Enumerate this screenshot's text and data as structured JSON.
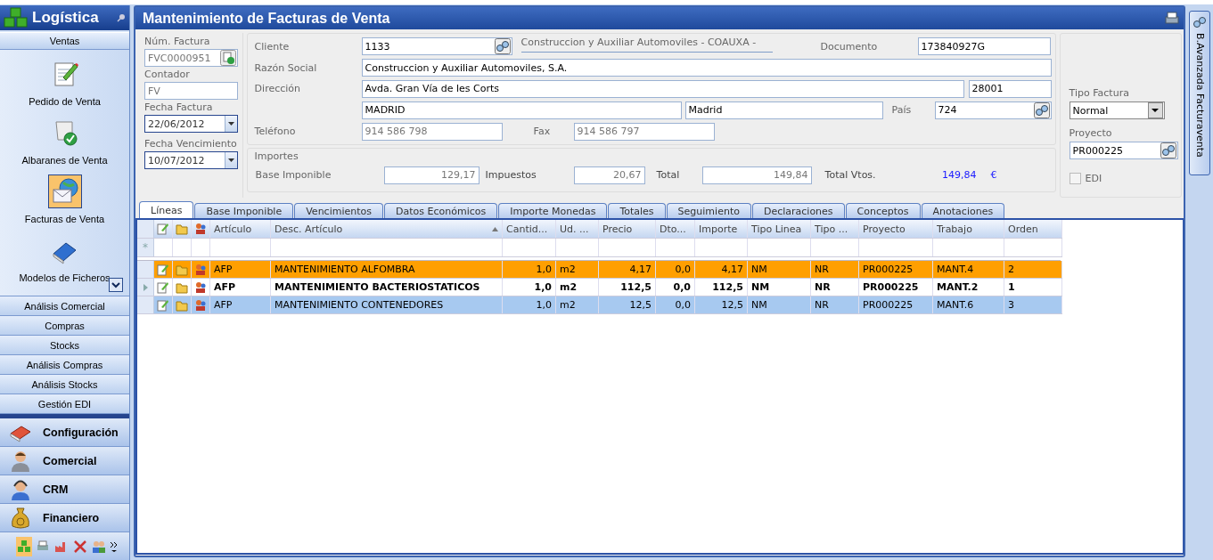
{
  "sidebar": {
    "title": "Logística",
    "section": {
      "label": "Ventas",
      "expanded": true,
      "items": [
        {
          "label": "Pedido de Venta",
          "selected": false
        },
        {
          "label": "Albaranes de Venta",
          "selected": false
        },
        {
          "label": "Facturas de Venta",
          "selected": true
        },
        {
          "label": "Modelos de Ficheros",
          "selected": false
        }
      ]
    },
    "groups": [
      "Análisis Comercial",
      "Compras",
      "Stocks",
      "Análisis Compras",
      "Análisis Stocks",
      "Gestión EDI"
    ],
    "nav_buttons": [
      {
        "label": "Configuración"
      },
      {
        "label": "Comercial"
      },
      {
        "label": "CRM"
      },
      {
        "label": "Financiero"
      }
    ],
    "toolbar": [
      {
        "selected": true
      },
      {
        "selected": false
      },
      {
        "selected": false
      },
      {
        "selected": false
      },
      {
        "selected": false
      }
    ]
  },
  "window": {
    "title": "Mantenimiento de Facturas de Venta"
  },
  "invoice": {
    "num_factura": {
      "label": "Núm. Factura",
      "value": "FVC0000951"
    },
    "contador": {
      "label": "Contador",
      "value": "FV"
    },
    "fecha_factura": {
      "label": "Fecha Factura",
      "value": "22/06/2012"
    },
    "fecha_vencimiento": {
      "label": "Fecha Vencimiento",
      "value": "10/07/2012"
    }
  },
  "client": {
    "cliente": {
      "label": "Cliente",
      "value": "1133",
      "name": "Construccion y Auxiliar Automoviles - COAUXA -"
    },
    "documento": {
      "label": "Documento",
      "value": "173840927G"
    },
    "razon_social": {
      "label": "Razón Social",
      "value": "Construccion y Auxiliar Automoviles, S.A."
    },
    "direccion": {
      "label": "Dirección",
      "value": "Avda. Gran Vía de les Corts",
      "postal_code": "28001",
      "city": "MADRID",
      "province": "Madrid"
    },
    "pais": {
      "label": "País",
      "value": "724"
    },
    "telefono": {
      "label": "Teléfono",
      "value": "914 586 798"
    },
    "fax": {
      "label": "Fax",
      "value": "914 586 797"
    }
  },
  "importes": {
    "title": "Importes",
    "base_imponible": {
      "label": "Base Imponible",
      "value": "129,17"
    },
    "impuestos": {
      "label": "Impuestos",
      "value": "20,67"
    },
    "total": {
      "label": "Total",
      "value": "149,84"
    },
    "total_vtos": {
      "label": "Total Vtos.",
      "value": "149,84",
      "currency": "€"
    }
  },
  "options": {
    "tipo_factura": {
      "label": "Tipo Factura",
      "value": "Normal"
    },
    "proyecto": {
      "label": "Proyecto",
      "value": "PR000225"
    },
    "edi": {
      "label": "EDI",
      "checked": false
    }
  },
  "tabs": [
    {
      "label": "Líneas",
      "selected": true
    },
    {
      "label": "Base Imponible",
      "selected": false
    },
    {
      "label": "Vencimientos",
      "selected": false
    },
    {
      "label": "Datos Económicos",
      "selected": false
    },
    {
      "label": "Importe Monedas",
      "selected": false
    },
    {
      "label": "Totales",
      "selected": false
    },
    {
      "label": "Seguimiento",
      "selected": false
    },
    {
      "label": "Declaraciones",
      "selected": false
    },
    {
      "label": "Conceptos",
      "selected": false
    },
    {
      "label": "Anotaciones",
      "selected": false
    }
  ],
  "table": {
    "new_row_marker": "*",
    "columns": [
      {
        "label": "Artículo"
      },
      {
        "label": "Desc. Artículo"
      },
      {
        "label": "Cantid..."
      },
      {
        "label": "Ud. ..."
      },
      {
        "label": "Precio"
      },
      {
        "label": "Dto..."
      },
      {
        "label": "Importe"
      },
      {
        "label": "Tipo Linea"
      },
      {
        "label": "Tipo ..."
      },
      {
        "label": "Proyecto"
      },
      {
        "label": "Trabajo"
      },
      {
        "label": "Orden"
      }
    ],
    "rows": [
      {
        "marked": true,
        "current": false,
        "selected": false,
        "cells": [
          "AFP",
          "MANTENIMIENTO ALFOMBRA",
          "1,0",
          "m2",
          "4,17",
          "0,0",
          "4,17",
          "NM",
          "NR",
          "PR000225",
          "MANT.4",
          "2"
        ]
      },
      {
        "marked": false,
        "current": true,
        "selected": false,
        "cells": [
          "AFP",
          "MANTENIMIENTO BACTERIOSTATICOS",
          "1,0",
          "m2",
          "112,5",
          "0,0",
          "112,5",
          "NM",
          "NR",
          "PR000225",
          "MANT.2",
          "1"
        ]
      },
      {
        "marked": false,
        "current": false,
        "selected": true,
        "cells": [
          "AFP",
          "MANTENIMIENTO CONTENEDORES",
          "1,0",
          "m2",
          "12,5",
          "0,0",
          "12,5",
          "NM",
          "NR",
          "PR000225",
          "MANT.6",
          "3"
        ]
      }
    ]
  },
  "side_tab": {
    "label": "B.Avanzada Facturaventa"
  }
}
